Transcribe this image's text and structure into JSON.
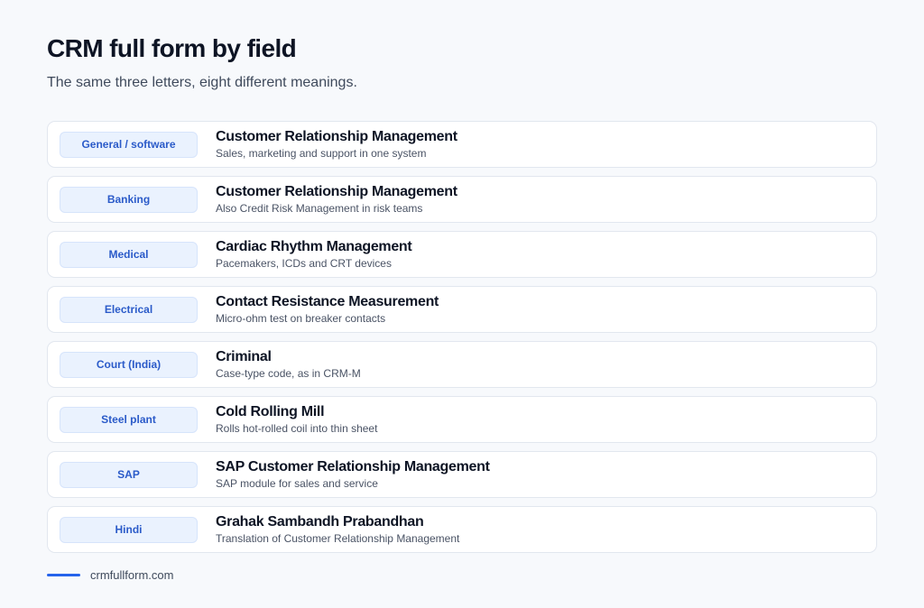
{
  "header": {
    "title": "CRM full form by field",
    "subtitle": "The same three letters, eight different meanings."
  },
  "rows": [
    {
      "field": "General / software",
      "term": "Customer Relationship Management",
      "description": "Sales, marketing and support in one system"
    },
    {
      "field": "Banking",
      "term": "Customer Relationship Management",
      "description": "Also Credit Risk Management in risk teams"
    },
    {
      "field": "Medical",
      "term": "Cardiac Rhythm Management",
      "description": "Pacemakers, ICDs and CRT devices"
    },
    {
      "field": "Electrical",
      "term": "Contact Resistance Measurement",
      "description": "Micro-ohm test on breaker contacts"
    },
    {
      "field": "Court (India)",
      "term": "Criminal",
      "description": "Case-type code, as in CRM-M"
    },
    {
      "field": "Steel plant",
      "term": "Cold Rolling Mill",
      "description": "Rolls hot-rolled coil into thin sheet"
    },
    {
      "field": "SAP",
      "term": "SAP Customer Relationship Management",
      "description": "SAP module for sales and service"
    },
    {
      "field": "Hindi",
      "term": "Grahak Sambandh Prabandhan",
      "description": "Translation of Customer Relationship Management"
    }
  ],
  "footer": {
    "source": "crmfullform.com"
  },
  "colors": {
    "accent": "#2563eb",
    "pill_text": "#2b5bc9",
    "pill_bg": "#eaf2fe"
  }
}
